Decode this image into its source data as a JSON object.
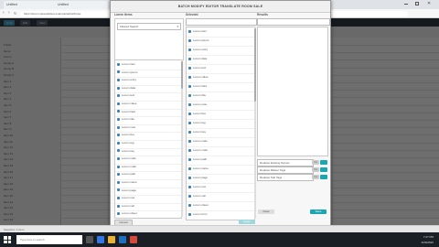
{
  "browser": {
    "tabs": [
      "Untitled",
      "Untitled"
    ],
    "url": "https://lorem.spreadsheet.example/editor#rows"
  },
  "app": {
    "buttons": [
      "Cmd",
      "Edit",
      "View"
    ]
  },
  "modal": {
    "title": "BATCH MODIFY EDITOR TRANSLATE ROOM SALE",
    "col1_header": "Lorem Items",
    "col2_header": "Selected",
    "col3_header": "Results",
    "select_value": "Filtered Search",
    "left_list": [
      "Lorem item",
      "Lorem ipsum",
      "Lorem entry",
      "Lorem data",
      "Lorem text",
      "Lorem value",
      "Lorem field",
      "Lorem title",
      "Lorem note",
      "Lorem line",
      "Lorem tag",
      "Lorem key",
      "Lorem code",
      "Lorem mark",
      "Lorem path",
      "Lorem name",
      "Lorem page",
      "Lorem row",
      "Lorem cell",
      "Lorem sheet"
    ],
    "mid_list": [
      "Lorem item",
      "Lorem ipsum",
      "Lorem entry",
      "Lorem data",
      "Lorem text",
      "Lorem value",
      "Lorem field",
      "Lorem title",
      "Lorem note",
      "Lorem line",
      "Lorem tag",
      "Lorem key",
      "Lorem code",
      "Lorem mark",
      "Lorem path",
      "Lorem name",
      "Lorem page",
      "Lorem row",
      "Lorem cell",
      "Lorem sheet",
      "Lorem form"
    ],
    "options": [
      "Replace Existing Names",
      "Replace Master Tags",
      "Replace Sub Tags"
    ],
    "toggle_label": "Yes",
    "cancel_label": "Cancel",
    "apply_label": "Apply",
    "save_label": "Save",
    "clear_label": "Clear"
  },
  "left_tree": [
    "Folder",
    "Items",
    "Lorem",
    "Group A",
    "Group B",
    "Group C",
    "Item 1",
    "Item 2",
    "Item 3",
    "Item 4",
    "Item 5",
    "Item 6",
    "Item 7",
    "Item 8",
    "Item 9",
    "Item 10",
    "Item 11",
    "Item 12",
    "Item 13",
    "Item 14",
    "Item 15",
    "Item 16",
    "Item 17",
    "Item 18",
    "Item 19",
    "Item 20",
    "Item 21",
    "Item 22",
    "Item 23",
    "Item 24"
  ],
  "statusbar": {
    "text": "Selection: 1 Item"
  },
  "taskbar": {
    "search_placeholder": "Type here to search",
    "time": "7:27 PM",
    "date": "4/29/2020"
  }
}
